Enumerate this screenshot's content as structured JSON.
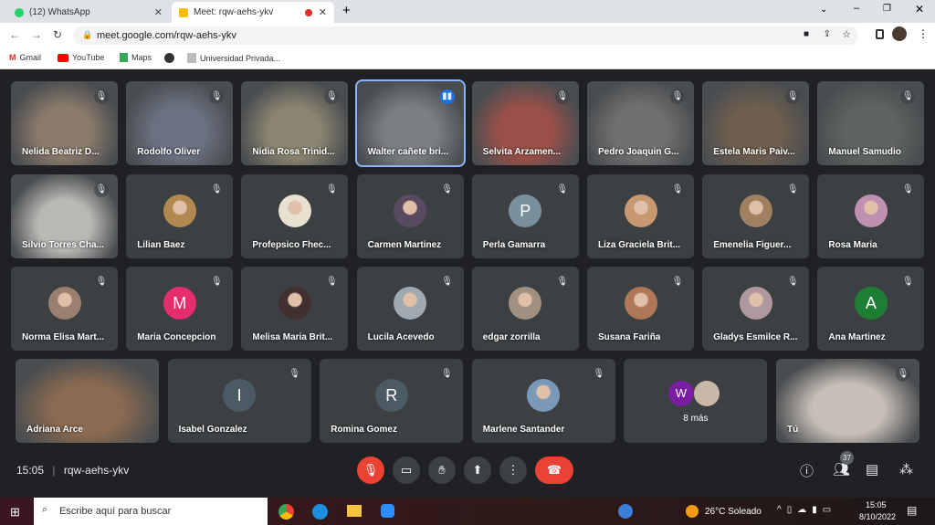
{
  "browser": {
    "tabs": [
      {
        "title": "(12) WhatsApp",
        "icon": "whatsapp-icon"
      },
      {
        "title": "Meet: rqw-aehs-ykv",
        "icon": "meet-icon",
        "recording": true
      }
    ],
    "url": "meet.google.com/rqw-aehs-ykv",
    "bookmarks": [
      "Gmail",
      "YouTube",
      "Maps",
      "",
      "Universidad Privada..."
    ]
  },
  "meet": {
    "participants": [
      {
        "name": "Nelida Beatriz D...",
        "video": true,
        "color": "#8a7a6a"
      },
      {
        "name": "Rodolfo Oliver",
        "video": true,
        "color": "#6a7180"
      },
      {
        "name": "Nidia Rosa Trinid...",
        "video": true,
        "color": "#8a8470"
      },
      {
        "name": "Walter cañete bri...",
        "video": true,
        "color": "#7b7f84",
        "speaking": true
      },
      {
        "name": "Selvita Arzamen...",
        "video": true,
        "color": "#9a5048"
      },
      {
        "name": "Pedro Joaquin G...",
        "video": true,
        "color": "#707070"
      },
      {
        "name": "Estela Maris Paiv...",
        "video": true,
        "color": "#6e5e4e"
      },
      {
        "name": "Manuel Samudio",
        "video": true,
        "color": "#5e6460"
      },
      {
        "name": "Silvio Torres Cha...",
        "video": true,
        "color": "#b8b8b4"
      },
      {
        "name": "Lilian Baez",
        "avatar": "photo",
        "color": "#b08850"
      },
      {
        "name": "Profepsico Fhec...",
        "avatar": "photo",
        "color": "#e8e0d0"
      },
      {
        "name": "Carmen Martinez",
        "avatar": "photo",
        "color": "#5a4a60"
      },
      {
        "name": "Perla Gamarra",
        "initial": "P",
        "color": "#78909c"
      },
      {
        "name": "Liza Graciela Brit...",
        "avatar": "photo",
        "color": "#c89870"
      },
      {
        "name": "Emenelia Figuer...",
        "avatar": "photo",
        "color": "#a08060"
      },
      {
        "name": "Rosa Maria",
        "avatar": "photo",
        "color": "#c090b0"
      },
      {
        "name": "Norma Elisa Mart...",
        "avatar": "photo",
        "color": "#9a8070"
      },
      {
        "name": "Maria Concepcion",
        "initial": "M",
        "color": "#e52d6e"
      },
      {
        "name": "Melisa Maria Brit...",
        "avatar": "photo",
        "color": "#403030"
      },
      {
        "name": "Lucila Acevedo",
        "avatar": "photo",
        "color": "#a0a8b0"
      },
      {
        "name": "edgar zorrilla",
        "avatar": "photo",
        "color": "#a09080"
      },
      {
        "name": "Susana Fariña",
        "avatar": "photo",
        "color": "#b07858"
      },
      {
        "name": "Gladys Esmilce R...",
        "avatar": "photo",
        "color": "#b098a0"
      },
      {
        "name": "Ana Martinez",
        "initial": "A",
        "color": "#1e7e34"
      },
      {
        "name": "Adriana Arce",
        "video": true,
        "color": "#8a6a50"
      },
      {
        "name": "Isabel Gonzalez",
        "initial": "I",
        "color": "#4b5a63"
      },
      {
        "name": "Romina Gomez",
        "initial": "R",
        "color": "#4b5a63"
      },
      {
        "name": "Marlene Santander",
        "avatar": "photo",
        "color": "#7a98b8"
      },
      {
        "name": "8 más",
        "more": true
      },
      {
        "name": "Tú",
        "video": true,
        "color": "#c8c0b8"
      }
    ],
    "more_initial": "W",
    "time": "15:05",
    "meeting_code": "rqw-aehs-ykv",
    "participant_count": "37"
  },
  "taskbar": {
    "search_placeholder": "Escribe aquí para buscar",
    "weather": "26°C  Soleado",
    "clock_time": "15:05",
    "clock_date": "8/10/2022"
  },
  "colors": {
    "end_call": "#ea4335",
    "mic_off": "#ea4335",
    "background": "#202124"
  }
}
